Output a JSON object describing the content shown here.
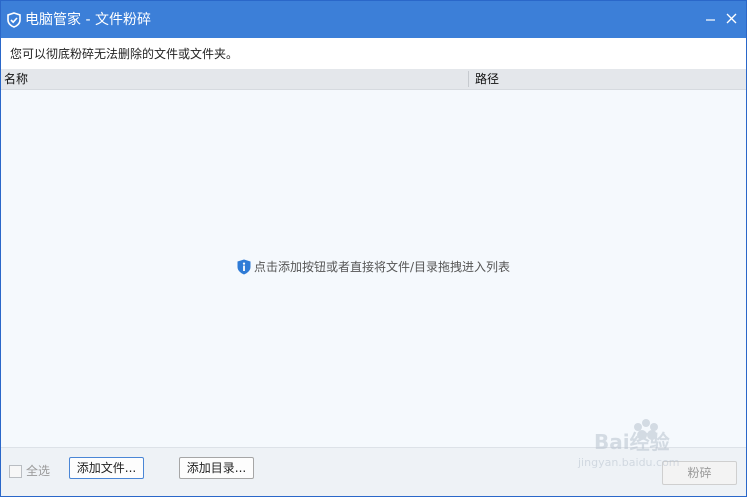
{
  "window": {
    "title": "电脑管家 - 文件粉碎",
    "app_icon": "shield-icon",
    "minimize_icon": "minimize-icon",
    "close_icon": "close-icon"
  },
  "description": "您可以彻底粉碎无法删除的文件或文件夹。",
  "list": {
    "columns": [
      "名称",
      "路径"
    ],
    "empty_hint": "点击添加按钮或者直接将文件/目录拖拽进入列表",
    "empty_hint_icon": "info-icon"
  },
  "footer": {
    "select_all_label": "全选",
    "select_all_checked": false,
    "add_file_label": "添加文件...",
    "add_dir_label": "添加目录...",
    "shred_label": "粉碎"
  },
  "watermark": {
    "brand": "Bai经验",
    "url": "jingyan.baidu.com"
  },
  "colors": {
    "titlebar": "#3c7fd8",
    "body_bg": "#f5f9fd",
    "header_bg": "#e4e7eb",
    "info_icon": "#2f7bd6"
  }
}
